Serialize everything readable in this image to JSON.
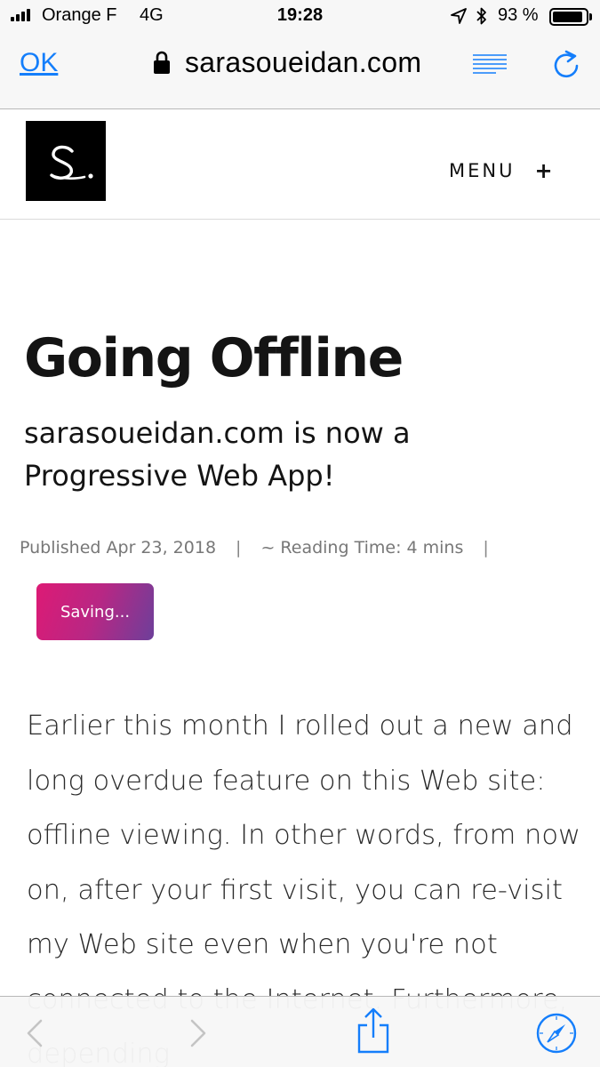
{
  "status_bar": {
    "carrier": "Orange F",
    "network": "4G",
    "time": "19:28",
    "battery_percent": "93 %",
    "battery_level": 0.93,
    "signal_bars": 4
  },
  "browser": {
    "done_label": "OK",
    "domain": "sarasoueidan.com",
    "accent_color": "#147efb"
  },
  "site": {
    "logo_letter": "S.",
    "menu_label": "MENU",
    "menu_plus": "+"
  },
  "article": {
    "title": "Going Offline",
    "subtitle": "sarasoueidan.com is now a Progressive Web App!",
    "published": "Published Apr 23, 2018",
    "separator": "|",
    "reading_time": "~ Reading Time: 4 mins",
    "save_button": "Saving...",
    "save_gradient": [
      "#dd1a75",
      "#6d3f9a"
    ],
    "body": "Earlier this month I rolled out a new and long overdue feature on this Web site: offline viewing. In other words, from now on, after your first visit, you can re-visit my Web site even when you're not connected to the Internet. Furthermore, depending"
  },
  "toolbar": {
    "icons": [
      "back-icon",
      "forward-icon",
      "share-icon",
      "compass-icon"
    ]
  }
}
